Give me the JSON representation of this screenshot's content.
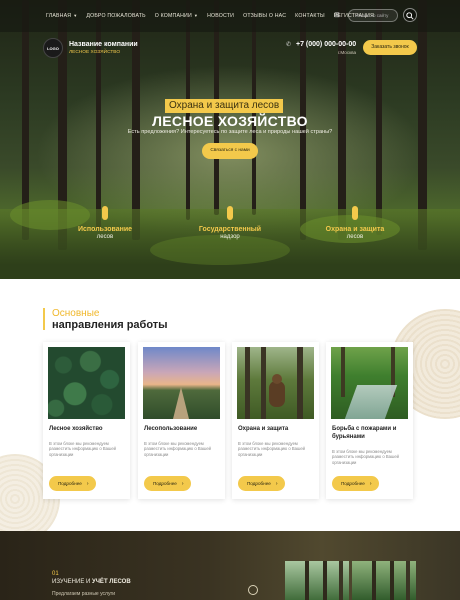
{
  "nav": {
    "items": [
      {
        "label": "ГЛАВНАЯ",
        "dropdown": true
      },
      {
        "label": "ДОБРО ПОЖАЛОВАТЬ",
        "dropdown": false
      },
      {
        "label": "О КОМПАНИИ",
        "dropdown": true
      },
      {
        "label": "НОВОСТИ",
        "dropdown": false
      },
      {
        "label": "ОТЗЫВЫ О НАС",
        "dropdown": false
      },
      {
        "label": "КОНТАКТЫ",
        "dropdown": false
      },
      {
        "label": "РЕГИСТРАЦИЯ",
        "dropdown": false
      }
    ],
    "search_placeholder": "Искать по сайту"
  },
  "header": {
    "logo_text": "LOGO",
    "company_name": "Название компании",
    "company_sub": "ЛЕСНОЕ ХОЗЯЙСТВО",
    "phone": "+7 (000) 000-00-00",
    "city": "г.Москва",
    "call_button": "Заказать звонок"
  },
  "hero": {
    "tag": "Охрана и защита лесов",
    "title": "ЛЕСНОЕ ХОЗЯЙСТВО",
    "subtitle": "Есть предложения? Интересуетесь по защите леса и природы нашей страны?",
    "button": "Связаться с нами",
    "features": [
      {
        "line1": "Использование",
        "line2": "лесов"
      },
      {
        "line1": "Государственный",
        "line2": "надзор"
      },
      {
        "line1": "Охрана и защита",
        "line2": "лесов"
      }
    ]
  },
  "directions": {
    "title_line1": "Основные",
    "title_line2": "направления работы",
    "cards": [
      {
        "title": "Лесное хозяйство",
        "desc": "В этом блоке мы рекомендуем разместить информацию о Вашей организации",
        "button": "Подробнее"
      },
      {
        "title": "Лесопользование",
        "desc": "В этом блоке мы рекомендуем разместить информацию о Вашей организации",
        "button": "Подробнее"
      },
      {
        "title": "Охрана и защита",
        "desc": "В этом блоке мы рекомендуем разместить информацию о Вашей организации",
        "button": "Подробнее"
      },
      {
        "title": "Борьба с пожарами и бурьянами",
        "desc": "В этом блоке мы рекомендуем разместить информацию о Вашей организации",
        "button": "Подробнее"
      }
    ]
  },
  "section3": {
    "number": "01",
    "title_plain": "ИЗУЧЕНИЕ И",
    "title_bold": "УЧЁТ ЛЕСОВ",
    "desc": "Предлагаем разные услуги"
  },
  "icons": {
    "search": "search-icon",
    "phone": "phone-icon",
    "visually_impaired": "eye-icon",
    "arrow": "arrow-right-icon"
  },
  "colors": {
    "accent": "#f3c94b",
    "title_accent": "#f0b82c"
  }
}
